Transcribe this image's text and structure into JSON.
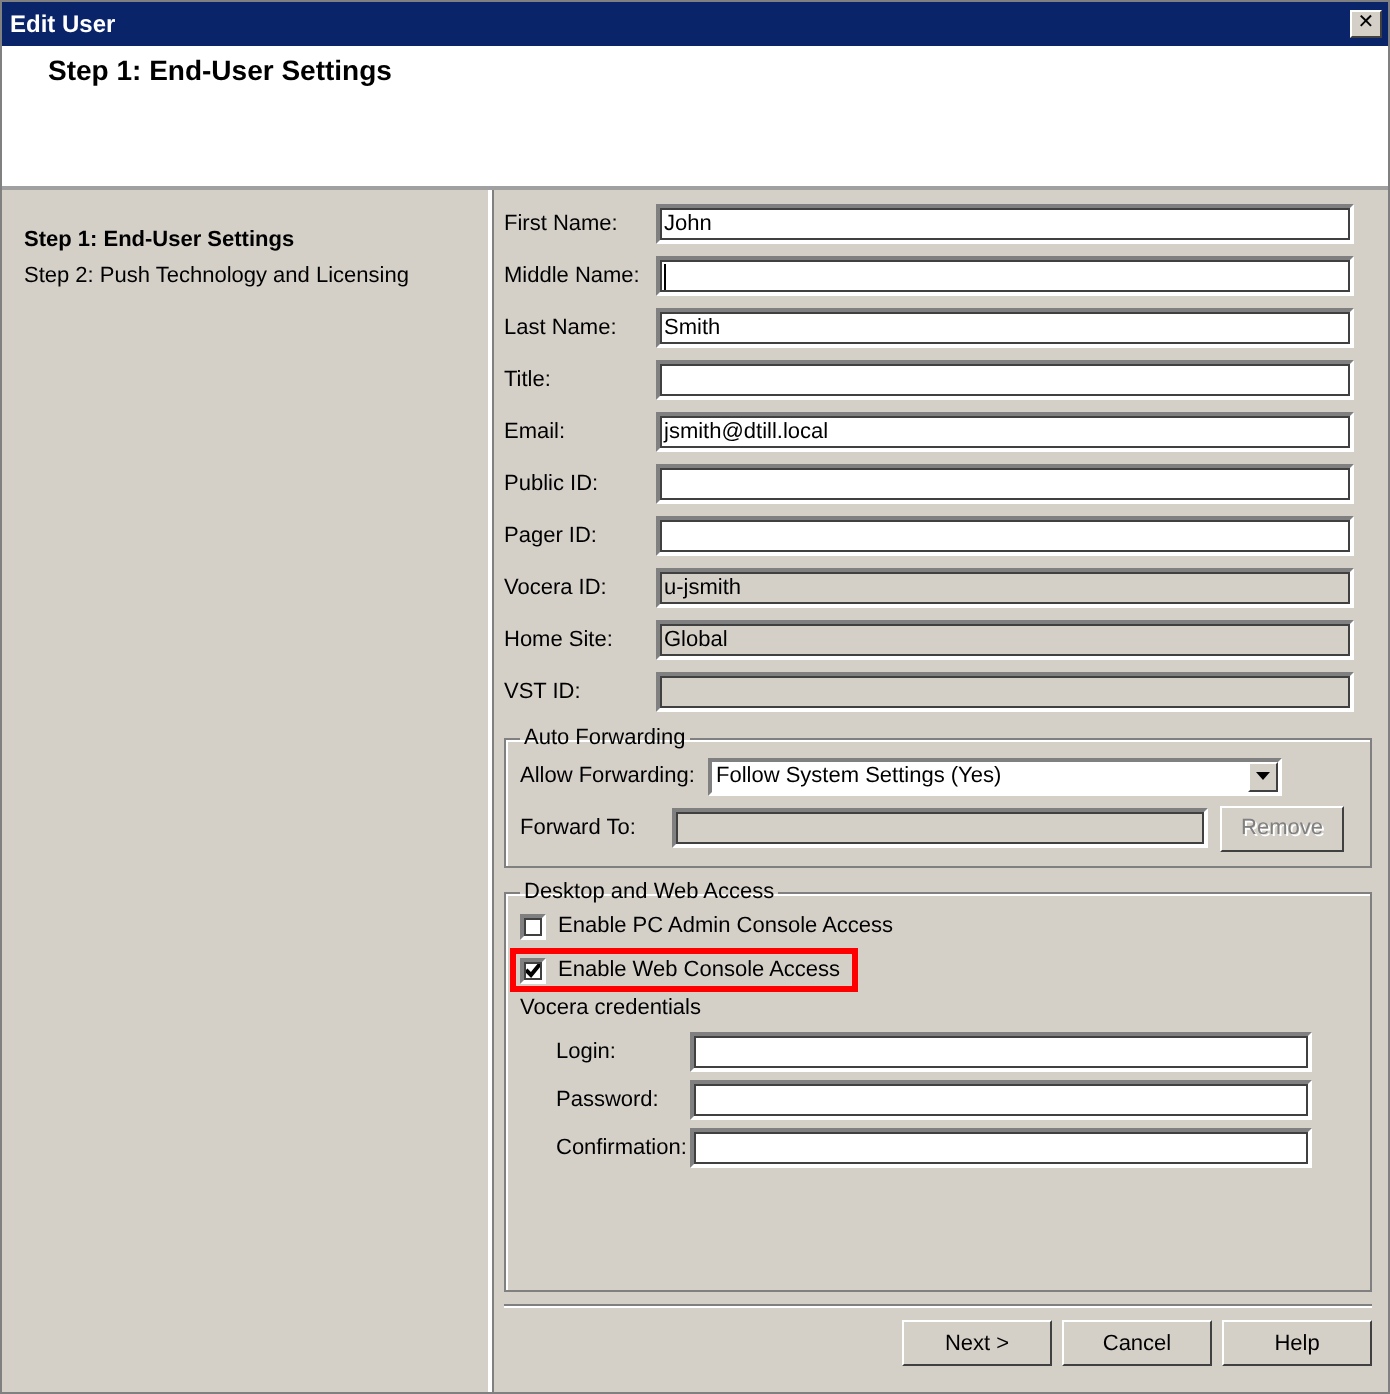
{
  "window": {
    "title": "Edit User",
    "close": "✕"
  },
  "header": {
    "title": "Step 1: End-User Settings"
  },
  "steps": [
    {
      "label": "Step 1: End-User Settings",
      "selected": true
    },
    {
      "label": "Step 2: Push Technology and Licensing",
      "selected": false
    }
  ],
  "fields": [
    {
      "label": "First Name:",
      "value": "John",
      "disabled": false,
      "focused": false
    },
    {
      "label": "Middle Name:",
      "disabled": false,
      "focused": true
    },
    {
      "label": "Last Name:",
      "value": "Smith",
      "disabled": false,
      "focused": false
    },
    {
      "label": "Title:",
      "disabled": false,
      "focused": false
    },
    {
      "label": "Email:",
      "value": "jsmith@dtill.local",
      "disabled": false,
      "focused": false
    },
    {
      "label": "Public ID:",
      "disabled": false,
      "focused": false
    },
    {
      "label": "Pager ID:",
      "disabled": false,
      "focused": false
    },
    {
      "label": "Vocera ID:",
      "value": "u-jsmith",
      "disabled": true,
      "focused": false
    },
    {
      "label": "Home Site:",
      "value": "Global",
      "disabled": true,
      "focused": false
    },
    {
      "label": "VST ID:",
      "disabled": true,
      "focused": false
    }
  ],
  "auto_forwarding": {
    "title": "Auto Forwarding",
    "allow_label": "Allow Forwarding:",
    "allow_value": "Follow System Settings (Yes)",
    "forward_label": "Forward To:",
    "remove_button": {
      "label": "Remove",
      "disabled": true
    }
  },
  "desktop_web_access": {
    "title": "Desktop and Web Access",
    "checkboxes": [
      {
        "label": "Enable PC Admin Console Access",
        "checked": false,
        "highlighted": false
      },
      {
        "label": "Enable Web Console Access",
        "checked": true,
        "highlighted": true
      }
    ],
    "credentials_title": "Vocera credentials",
    "credentials": [
      {
        "label": "Login:"
      },
      {
        "label": "Password:"
      },
      {
        "label": "Confirmation:"
      }
    ]
  },
  "buttons": [
    "Next >",
    "Cancel",
    "Help"
  ]
}
